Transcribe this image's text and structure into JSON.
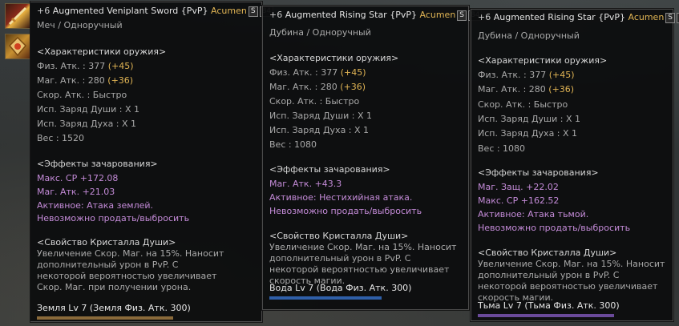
{
  "tooltips": [
    {
      "enchant": "+6",
      "name": "Augmented Veniplant Sword {PvP}",
      "tag": "Acumen",
      "badge_s": "S",
      "badge_level": "84",
      "type": "Меч / Одноручный",
      "stats_title": "<Характеристики оружия>",
      "stats": [
        {
          "label": "Физ. Атк. : 377",
          "bonus": "(+45)"
        },
        {
          "label": "Маг. Атк. : 280",
          "bonus": "(+36)"
        },
        {
          "label": "Скор. Атк. : Быстро",
          "bonus": ""
        },
        {
          "label": "Исп. Заряд Души : X 1",
          "bonus": ""
        },
        {
          "label": "Исп. Заряд Духа : X 1",
          "bonus": ""
        },
        {
          "label": "Вес : 1520",
          "bonus": ""
        }
      ],
      "effects_title": "<Эффекты зачарования>",
      "effects": [
        "Макс. СР +172.08",
        "Маг. Атк. +21.03",
        "Активное: Атака землей."
      ],
      "no_sell": "Невозможно продать/выбросить",
      "crystal_title": "<Свойство Кристалла Души>",
      "crystal_desc": "Увеличение Скор. Маг. на 15%. Наносит дополнительный урон в PvP. С некоторой вероятностью увеличивает Скор. Маг. при получении урона.",
      "attribute": "Земля Lv 7 (Земля Физ. Атк. 300)",
      "attribute_color": "#8a6a3a"
    },
    {
      "enchant": "+6",
      "name": "Augmented Rising Star {PvP}",
      "tag": "Acumen",
      "badge_s": "S",
      "badge_level": "84",
      "type": "Дубина / Одноручный",
      "stats_title": "<Характеристики оружия>",
      "stats": [
        {
          "label": "Физ. Атк. : 377",
          "bonus": "(+45)"
        },
        {
          "label": "Маг. Атк. : 280",
          "bonus": "(+36)"
        },
        {
          "label": "Скор. Атк. : Быстро",
          "bonus": ""
        },
        {
          "label": "Исп. Заряд Души : X 1",
          "bonus": ""
        },
        {
          "label": "Исп. Заряд Духа : X 1",
          "bonus": ""
        },
        {
          "label": "Вес : 1080",
          "bonus": ""
        }
      ],
      "effects_title": "<Эффекты зачарования>",
      "effects": [
        "Маг. Атк. +43.3",
        "Активное: Нестихийная атака."
      ],
      "no_sell": "Невозможно продать/выбросить",
      "crystal_title": "<Свойство Кристалла Души>",
      "crystal_desc": "Увеличение Скор. Маг. на 15%. Наносит дополнительный урон в PvP. С некоторой вероятностью увеличивает скорость магии.",
      "attribute": "Вода Lv 7 (Вода Физ. Атк. 300)",
      "attribute_color": "#2f5fa8"
    },
    {
      "enchant": "+6",
      "name": "Augmented Rising Star {PvP}",
      "tag": "Acumen",
      "badge_s": "S",
      "badge_level": "84",
      "type": "Дубина / Одноручный",
      "stats_title": "<Характеристики оружия>",
      "stats": [
        {
          "label": "Физ. Атк. : 377",
          "bonus": "(+45)"
        },
        {
          "label": "Маг. Атк. : 280",
          "bonus": "(+36)"
        },
        {
          "label": "Скор. Атк. : Быстро",
          "bonus": ""
        },
        {
          "label": "Исп. Заряд Души : X 1",
          "bonus": ""
        },
        {
          "label": "Исп. Заряд Духа : X 1",
          "bonus": ""
        },
        {
          "label": "Вес : 1080",
          "bonus": ""
        }
      ],
      "effects_title": "<Эффекты зачарования>",
      "effects": [
        "Маг. Защ. +22.02",
        "Макс. СР +162.52",
        "Активное: Атака тьмой."
      ],
      "no_sell": "Невозможно продать/выбросить",
      "crystal_title": "<Свойство Кристалла Души>",
      "crystal_desc": "Увеличение Скор. Маг. на 15%. Наносит дополнительный урон в PvP. С некоторой вероятностью увеличивает скорость магии.",
      "attribute": "Тьма Lv 7 (Тьма Физ. Атк. 300)",
      "attribute_color": "#6a4a9a"
    }
  ],
  "icons": [
    "sword-icon",
    "gem-icon"
  ]
}
